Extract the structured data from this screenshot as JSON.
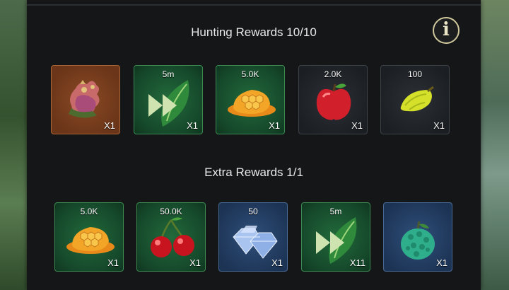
{
  "hunting": {
    "title": "Hunting Rewards 10/10",
    "items": [
      {
        "name": "meat",
        "amount": "",
        "qty": "X1"
      },
      {
        "name": "speedup",
        "amount": "5m",
        "qty": "X1"
      },
      {
        "name": "honeycomb",
        "amount": "5.0K",
        "qty": "X1"
      },
      {
        "name": "apple",
        "amount": "2.0K",
        "qty": "X1"
      },
      {
        "name": "starfruit",
        "amount": "100",
        "qty": "X1"
      }
    ]
  },
  "extra": {
    "title": "Extra Rewards  1/1",
    "items": [
      {
        "name": "honeycomb",
        "amount": "5.0K",
        "qty": "X1"
      },
      {
        "name": "cherries",
        "amount": "50.0K",
        "qty": "X1"
      },
      {
        "name": "diamonds",
        "amount": "50",
        "qty": "X1"
      },
      {
        "name": "speedup",
        "amount": "5m",
        "qty": "X11"
      },
      {
        "name": "custard-apple",
        "amount": "",
        "qty": "X1"
      }
    ]
  },
  "info_icon": "i",
  "colors": {
    "panel": "#141617",
    "green_card": "#1d5c33",
    "dark_card": "#23272c",
    "orange_card": "#7a3f1f",
    "blue_card": "#263f66",
    "info_ring": "#cfc79c"
  }
}
